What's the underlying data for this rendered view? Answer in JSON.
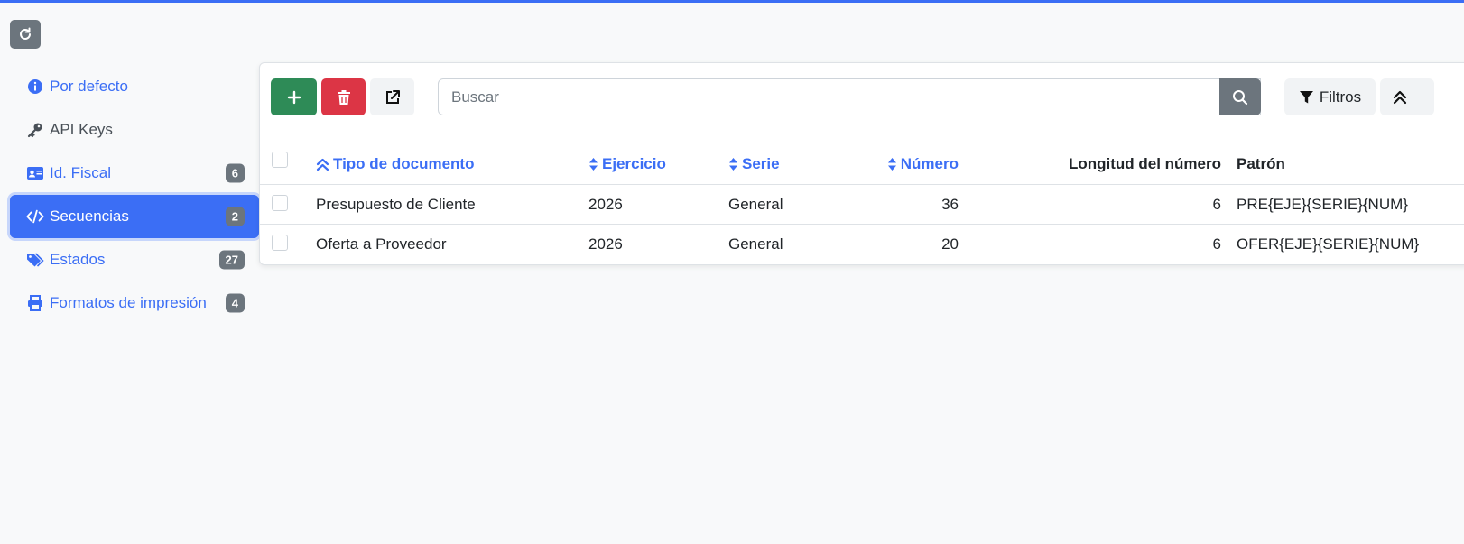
{
  "colors": {
    "accent": "#3b6ef5",
    "add": "#2e8b57",
    "delete": "#dc3545",
    "muted": "#6c757d"
  },
  "sidebar": {
    "items": [
      {
        "label": "Por defecto",
        "icon": "info-circle-icon"
      },
      {
        "label": "API Keys",
        "icon": "key-icon"
      },
      {
        "label": "Id. Fiscal",
        "icon": "id-card-icon",
        "badge": "6"
      },
      {
        "label": "Secuencias",
        "icon": "code-icon",
        "badge": "2",
        "active": true
      },
      {
        "label": "Estados",
        "icon": "tags-icon",
        "badge": "27"
      },
      {
        "label": "Formatos de impresión",
        "icon": "print-icon",
        "badge": "4"
      }
    ]
  },
  "toolbar": {
    "search_placeholder": "Buscar",
    "filters_label": "Filtros"
  },
  "table": {
    "columns": {
      "tipo": "Tipo de documento",
      "ejercicio": "Ejercicio",
      "serie": "Serie",
      "numero": "Número",
      "longitud": "Longitud del número",
      "patron": "Patrón"
    },
    "rows": [
      {
        "tipo": "Presupuesto de Cliente",
        "ejercicio": "2026",
        "serie": "General",
        "numero": "36",
        "longitud": "6",
        "patron": "PRE{EJE}{SERIE}{NUM}"
      },
      {
        "tipo": "Oferta a Proveedor",
        "ejercicio": "2026",
        "serie": "General",
        "numero": "20",
        "longitud": "6",
        "patron": "OFER{EJE}{SERIE}{NUM}"
      }
    ]
  }
}
